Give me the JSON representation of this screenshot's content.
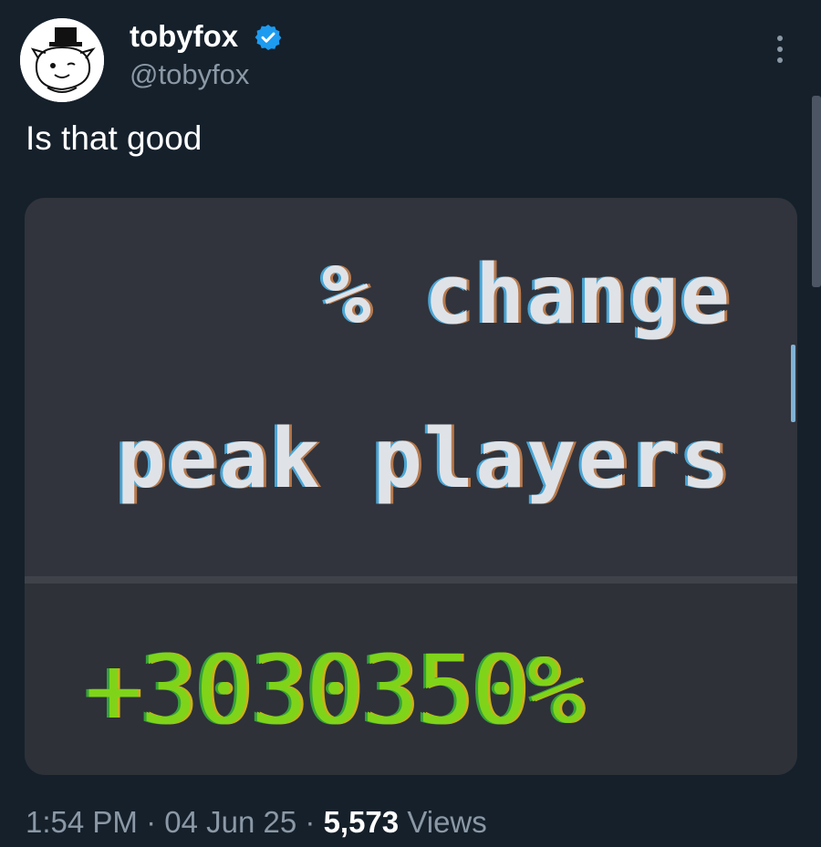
{
  "tweet": {
    "author": {
      "display_name": "tobyfox",
      "handle": "@tobyfox",
      "verified": true
    },
    "text": "Is that good",
    "media": {
      "heading_line1": "% change",
      "heading_line2": "peak players",
      "value": "+3030350%"
    },
    "meta": {
      "time": "1:54 PM",
      "separator": "·",
      "date": "04 Jun 25",
      "views_count": "5,573",
      "views_label": "Views"
    }
  },
  "colors": {
    "background": "#15202b",
    "verified_blue": "#1d9bf0",
    "value_green": "#7fd41a",
    "muted_text": "#8b98a5"
  },
  "icons": {
    "more": "more-vertical-icon",
    "verified": "verified-badge-icon"
  }
}
